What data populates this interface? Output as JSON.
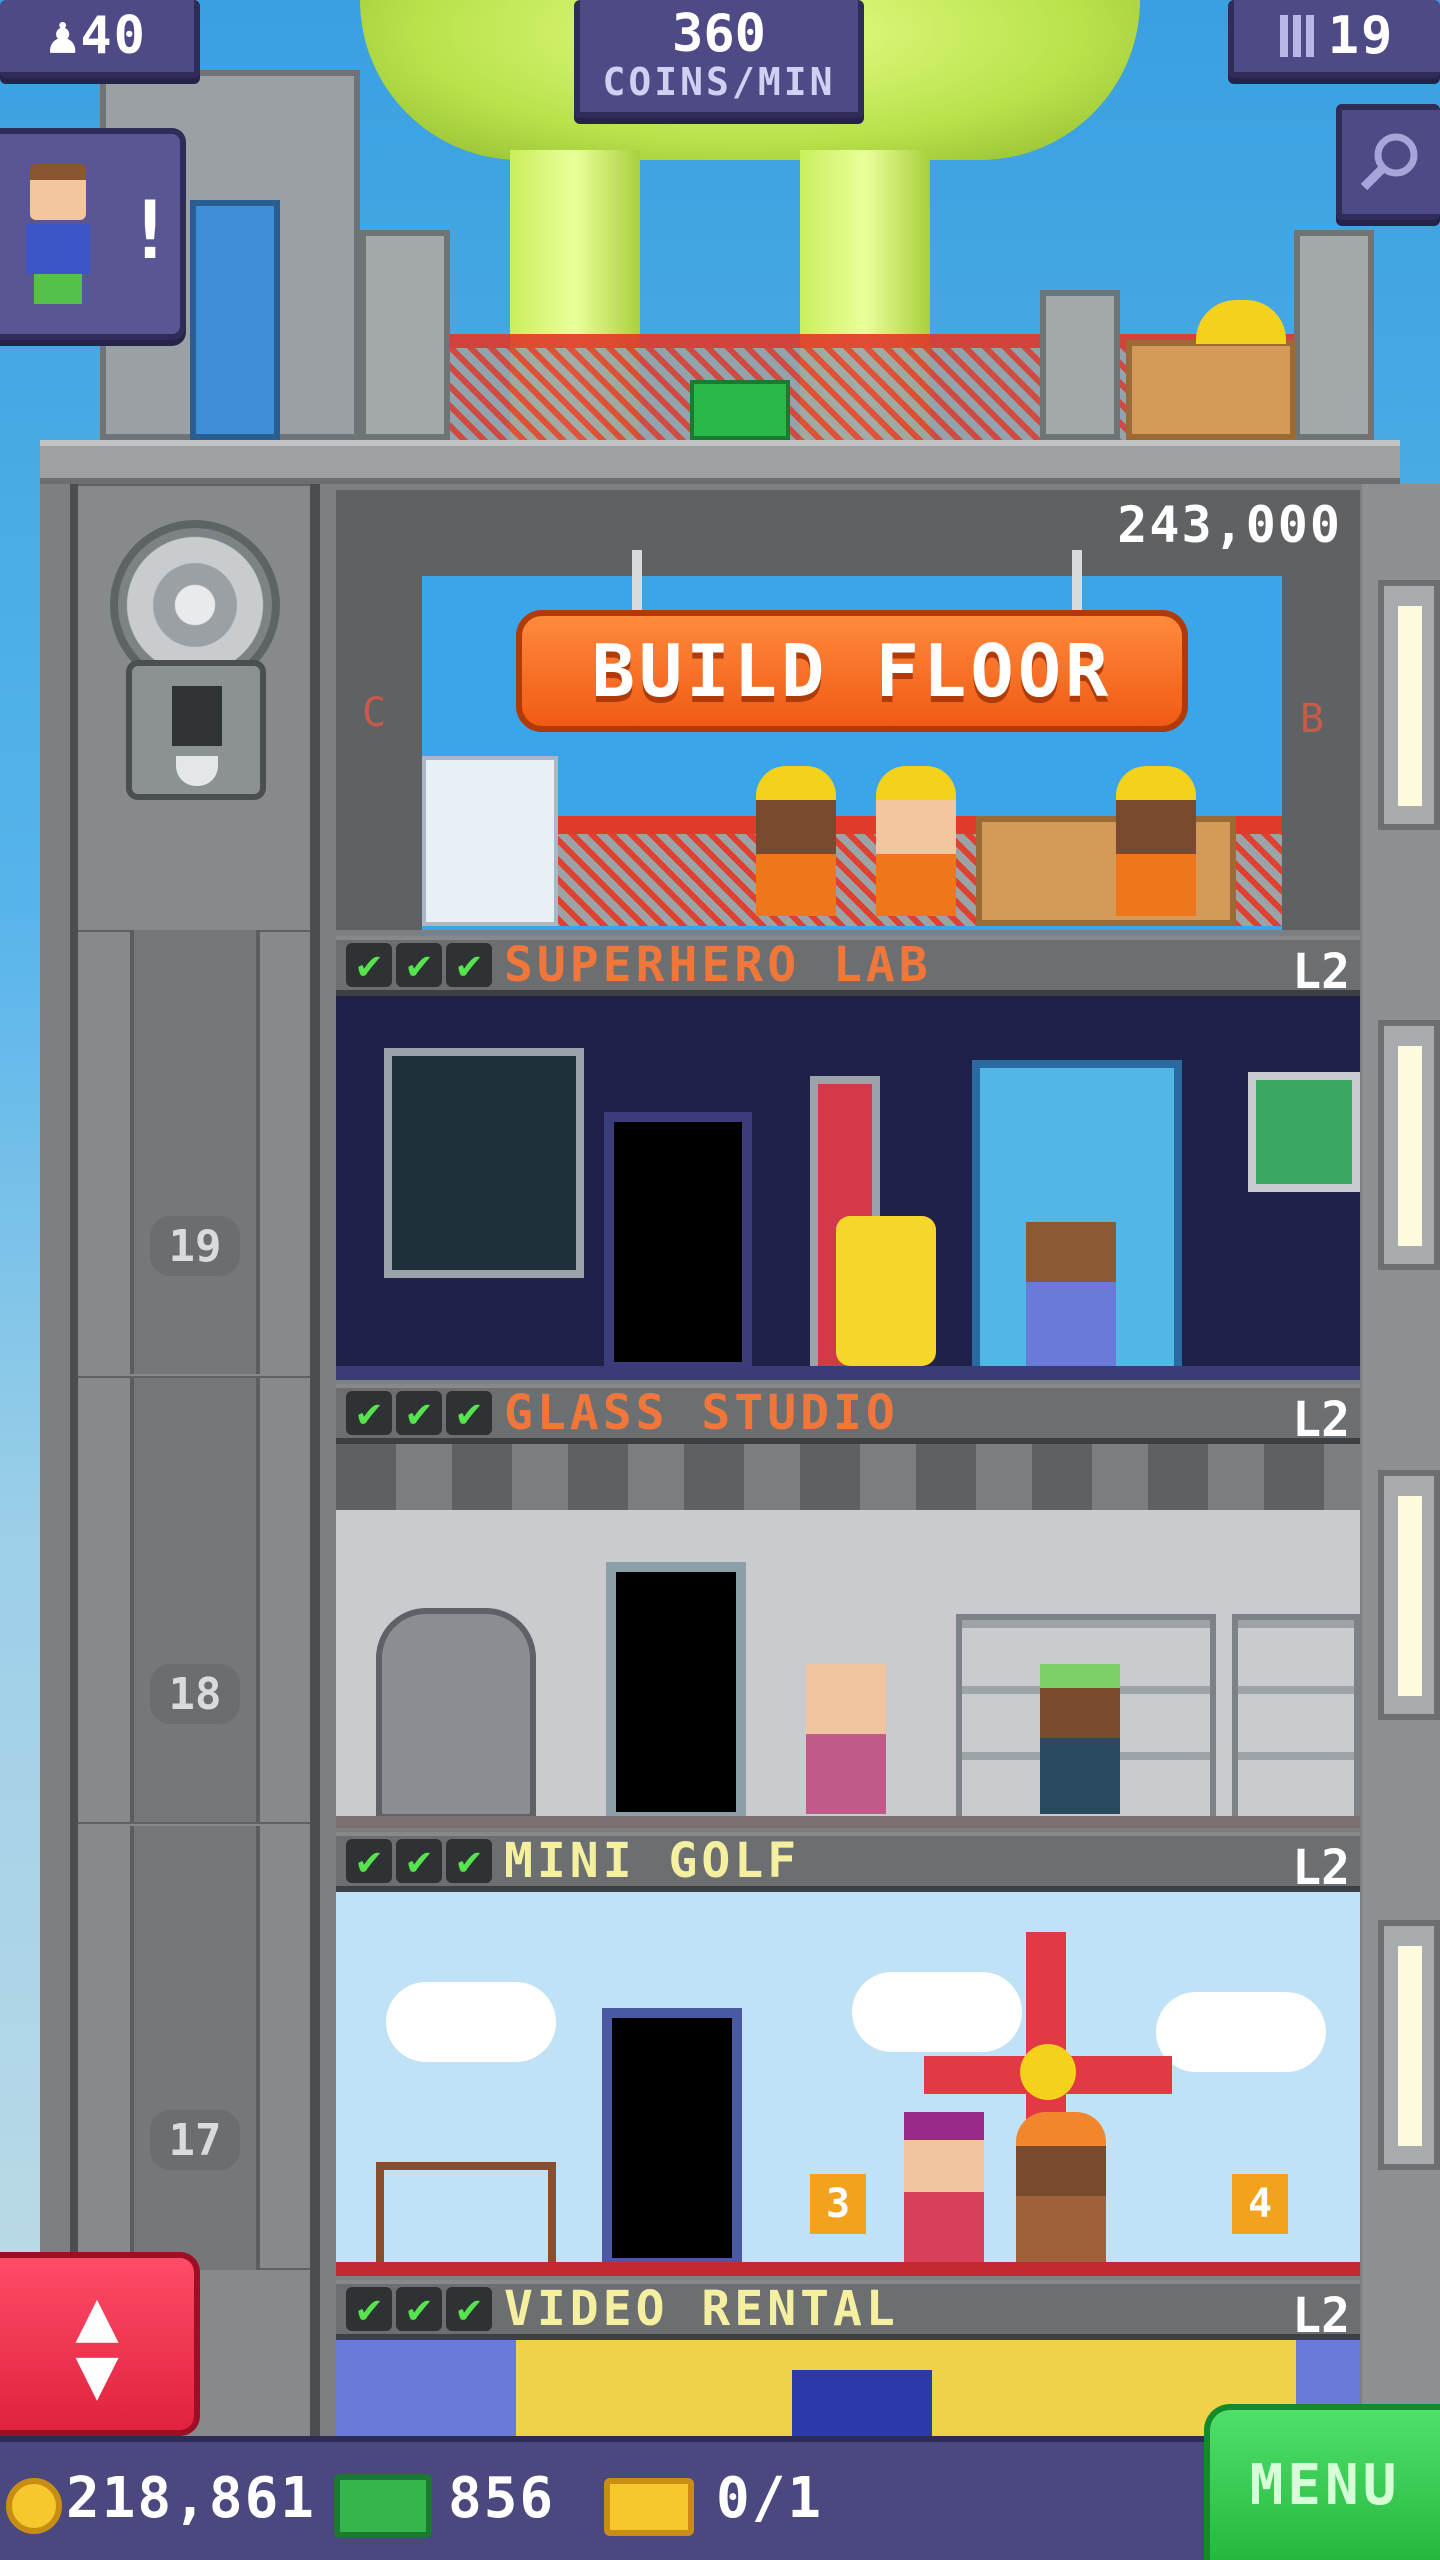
{
  "hud": {
    "population": "40",
    "population_icon": "person-icon",
    "coins_per_min": "360",
    "coins_per_min_unit": "COINS/MIN",
    "floors": "19",
    "floors_icon": "building-icon",
    "zoom_icon": "magnifier-icon",
    "vip_alert": "!"
  },
  "build": {
    "cost": "243,000",
    "button_label": "BUILD FLOOR",
    "side_left": "C",
    "side_right": "B"
  },
  "floors": [
    {
      "name": "SUPERHERO LAB",
      "level": "L2",
      "color": "#f0763a",
      "checks": [
        "✔",
        "✔",
        "✔"
      ]
    },
    {
      "name": "GLASS STUDIO",
      "level": "L2",
      "color": "#f0763a",
      "checks": [
        "✔",
        "✔",
        "✔"
      ]
    },
    {
      "name": "MINI GOLF",
      "level": "L2",
      "color": "#f5f0a0",
      "checks": [
        "✔",
        "✔",
        "✔"
      ]
    },
    {
      "name": "VIDEO RENTAL",
      "level": "L2",
      "color": "#f5f0a0",
      "checks": [
        "✔",
        "✔",
        "✔"
      ]
    }
  ],
  "elevator": {
    "floor_numbers": [
      "19",
      "18",
      "17"
    ],
    "button_up": "▲",
    "button_down": "▼"
  },
  "golf_holes": [
    "3",
    "4"
  ],
  "status": {
    "coins": "218,861",
    "bux": "856",
    "tickets": "0/1",
    "menu_label": "MENU"
  },
  "colors": {
    "hud_bg": "#4e4a86",
    "build_button": "#f05a14",
    "menu_button": "#25b83e",
    "elevator_button": "#e0223f",
    "check_green": "#57e34f"
  }
}
